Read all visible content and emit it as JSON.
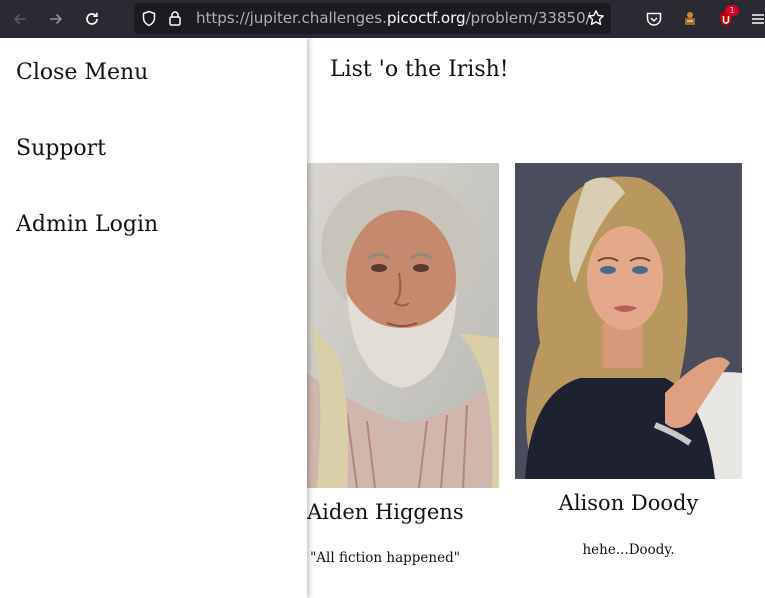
{
  "browser": {
    "url_prefix": "https://jupiter.challenges.",
    "url_host": "picoctf.org",
    "url_path": "/problem/33850/",
    "extension_badge": "1",
    "icons": [
      "back-arrow-icon",
      "forward-arrow-icon",
      "reload-icon",
      "shield-icon",
      "lock-icon",
      "bookmark-star-icon",
      "pocket-icon",
      "extension-icon",
      "ublock-icon",
      "hamburger-menu-icon"
    ]
  },
  "menu": {
    "items": [
      "Close Menu",
      "Support",
      "Admin Login"
    ]
  },
  "page": {
    "title": "List 'o the Irish!"
  },
  "people": [
    {
      "name": "Aiden Higgens",
      "quote": "\"All fiction happened\""
    },
    {
      "name": "Alison Doody",
      "quote": "hehe...Doody."
    }
  ],
  "colors": {
    "toolbar": "#2b2a33",
    "urlbar": "#1c1b22",
    "badge": "#d70022",
    "text": "#111111"
  }
}
